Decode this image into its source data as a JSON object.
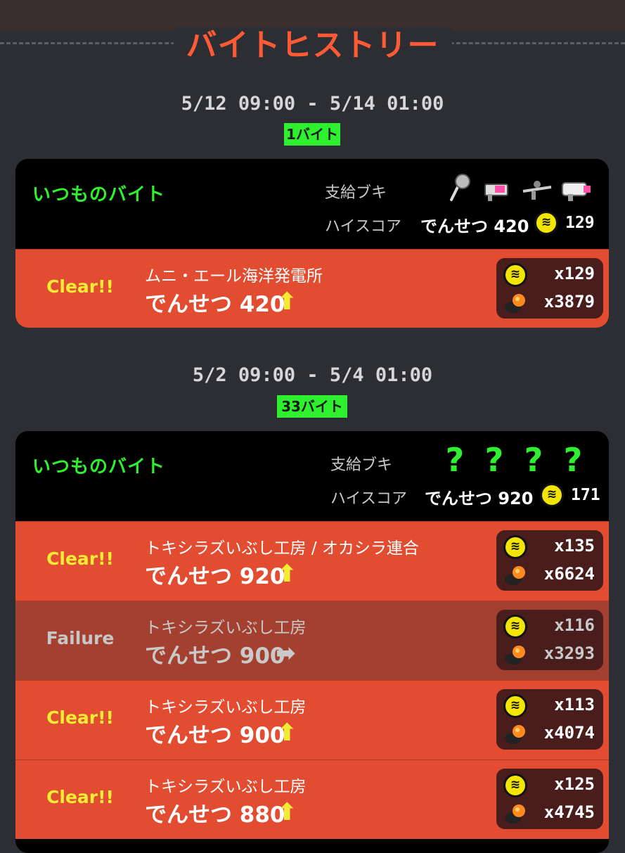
{
  "page": {
    "title": "バイトヒストリー"
  },
  "shifts": [
    {
      "period": "5/12 09:00 - 5/14 01:00",
      "count_badge": "1バイト",
      "mode": "いつものバイト",
      "weapons_label": "支給ブキ",
      "weapons": [
        "weapon-1",
        "weapon-2",
        "weapon-3",
        "weapon-4"
      ],
      "highscore_label": "ハイスコア",
      "highscore_text": "でんせつ 420",
      "highscore_eggs": "129",
      "jobs": [
        {
          "result": "Clear!!",
          "stage": "ムニ・エール海洋発電所",
          "score": "でんせつ 420",
          "trend": "up",
          "golden_eggs": "x129",
          "power_eggs": "x3879"
        }
      ]
    },
    {
      "period": "5/2 09:00 - 5/4 01:00",
      "count_badge": "33バイト",
      "mode": "いつものバイト",
      "weapons_label": "支給ブキ",
      "weapons_unknown": [
        "?",
        "?",
        "?",
        "?"
      ],
      "highscore_label": "ハイスコア",
      "highscore_text": "でんせつ 920",
      "highscore_eggs": "171",
      "jobs": [
        {
          "result": "Clear!!",
          "stage": "トキシラズいぶし工房 / オカシラ連合",
          "score": "でんせつ 920",
          "trend": "up",
          "golden_eggs": "x135",
          "power_eggs": "x6624"
        },
        {
          "result": "Failure",
          "stage": "トキシラズいぶし工房",
          "score": "でんせつ 900",
          "trend": "flat",
          "golden_eggs": "x116",
          "power_eggs": "x3293"
        },
        {
          "result": "Clear!!",
          "stage": "トキシラズいぶし工房",
          "score": "でんせつ 900",
          "trend": "up",
          "golden_eggs": "x113",
          "power_eggs": "x4074"
        },
        {
          "result": "Clear!!",
          "stage": "トキシラズいぶし工房",
          "score": "でんせつ 880",
          "trend": "up",
          "golden_eggs": "x125",
          "power_eggs": "x4745"
        }
      ]
    }
  ],
  "colors": {
    "accent_green": "#2ef02e",
    "clear_row": "#e24d31",
    "fail_row": "#a4402f",
    "title_red": "#ff5a36",
    "golden_egg": "#f2e500"
  },
  "icons": {
    "up": "arrow-up-icon",
    "flat": "arrow-right-icon",
    "golden": "golden-egg-icon",
    "power": "power-egg-icon"
  }
}
